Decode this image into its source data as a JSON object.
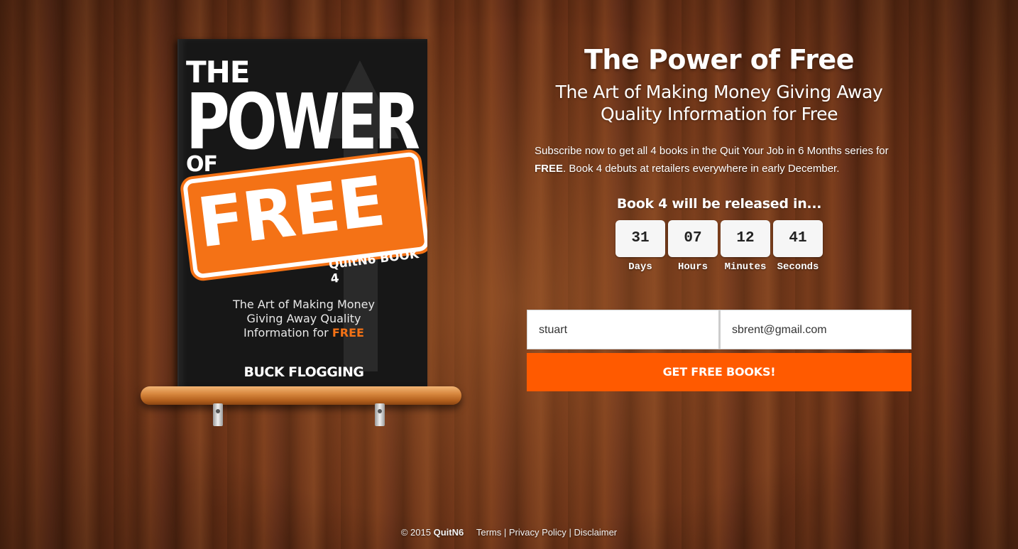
{
  "book": {
    "line1": "THE",
    "line2": "POWER",
    "line3": "OF",
    "line4": "FREE",
    "series": "QuitN6 BOOK 4",
    "subtitle_l1": "The Art of Making Money",
    "subtitle_l2": "Giving Away Quality",
    "subtitle_l3_a": "Information for",
    "subtitle_l3_b": "FREE",
    "author": "BUCK FLOGGING"
  },
  "hero": {
    "title": "The Power of Free",
    "subtitle_l1": "The Art of Making Money Giving Away",
    "subtitle_l2": "Quality Information for Free",
    "desc_a": "Subscribe now to get all 4 books in the Quit Your Job in 6 Months series for",
    "desc_b": "FREE",
    "desc_c": ". Book 4 debuts at retailers everywhere in early December.",
    "release": "Book 4 will be released in..."
  },
  "countdown": [
    {
      "value": "31",
      "label": "Days"
    },
    {
      "value": "07",
      "label": "Hours"
    },
    {
      "value": "12",
      "label": "Minutes"
    },
    {
      "value": "41",
      "label": "Seconds"
    }
  ],
  "form": {
    "name_value": "stuart",
    "email_value": "sbrent@gmail.com",
    "submit_label": "GET FREE BOOKS!"
  },
  "footer": {
    "copyright": "© 2015",
    "brand": "QuitN6",
    "terms": "Terms",
    "privacy": "Privacy Policy",
    "disclaimer": "Disclaimer",
    "sep": "|"
  },
  "colors": {
    "accent": "#ff5a00",
    "cover_orange": "#f47216"
  }
}
